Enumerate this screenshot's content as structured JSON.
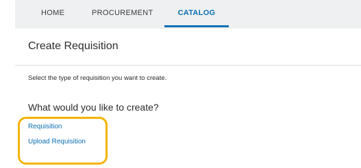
{
  "nav": {
    "tabs": [
      {
        "label": "HOME"
      },
      {
        "label": "PROCUREMENT"
      },
      {
        "label": "CATALOG",
        "active": true
      }
    ]
  },
  "header": {
    "title": "Create Requisition"
  },
  "main": {
    "instructions": "Select the type of requisition you want to create.",
    "question": "What would you like to create?",
    "options": [
      {
        "label": "Requisition"
      },
      {
        "label": "Upload Requisition"
      }
    ]
  },
  "colors": {
    "accent": "#0a6fb3",
    "nav_background": "#eef0f1",
    "highlight": "#f5b301"
  }
}
